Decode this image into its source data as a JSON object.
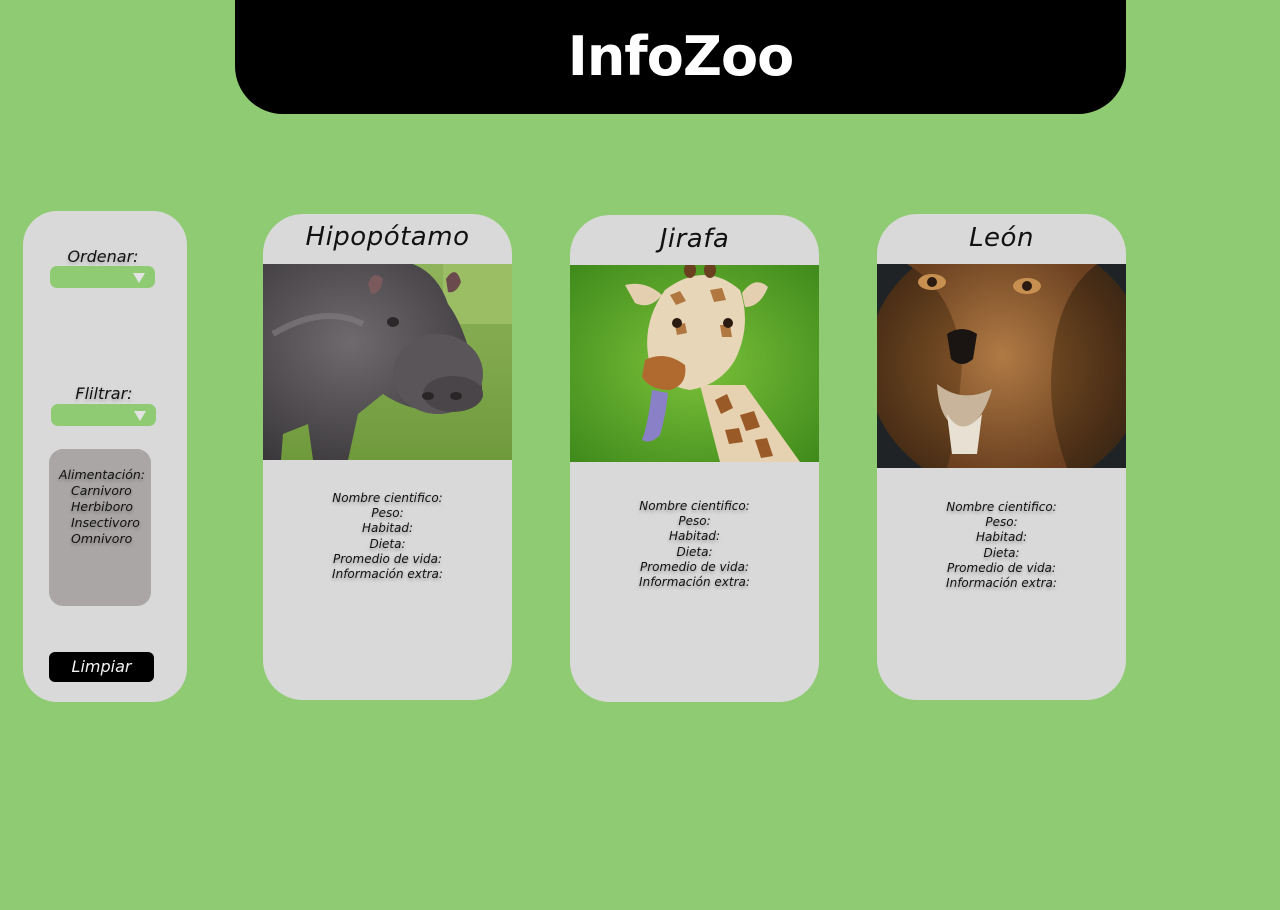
{
  "header": {
    "title": "InfoZoo"
  },
  "sidebar": {
    "order_label": "Ordenar:",
    "filter_label": "Fliltrar:",
    "filter_panel": {
      "title": "Alimentación:",
      "options": [
        "Carnivoro",
        "Herbiboro",
        "Insectivoro",
        "Omnivoro"
      ]
    },
    "clear_button": "Limpiar",
    "icons": {
      "order_dropdown": "triangle-down-icon",
      "filter_dropdown": "triangle-down-icon"
    }
  },
  "cards": [
    {
      "name": "Hipopótamo",
      "image": "hippo-photo",
      "fields": [
        "Nombre cientifico:",
        "Peso:",
        "Habitad:",
        "Dieta:",
        "Promedio de vida:",
        "Información extra:"
      ]
    },
    {
      "name": "Jirafa",
      "image": "giraffe-photo",
      "fields": [
        "Nombre cientifico:",
        "Peso:",
        "Habitad:",
        "Dieta:",
        "Promedio de vida:",
        "Información extra:"
      ]
    },
    {
      "name": "León",
      "image": "lion-photo",
      "fields": [
        "Nombre cientifico:",
        "Peso:",
        "Habitad:",
        "Dieta:",
        "Promedio de vida:",
        "Información extra:"
      ]
    }
  ],
  "colors": {
    "background": "#8fcb73",
    "header": "#000000",
    "panel": "#d9d9d9",
    "filter_panel": "#aba6a6",
    "select": "#8fcb73"
  }
}
